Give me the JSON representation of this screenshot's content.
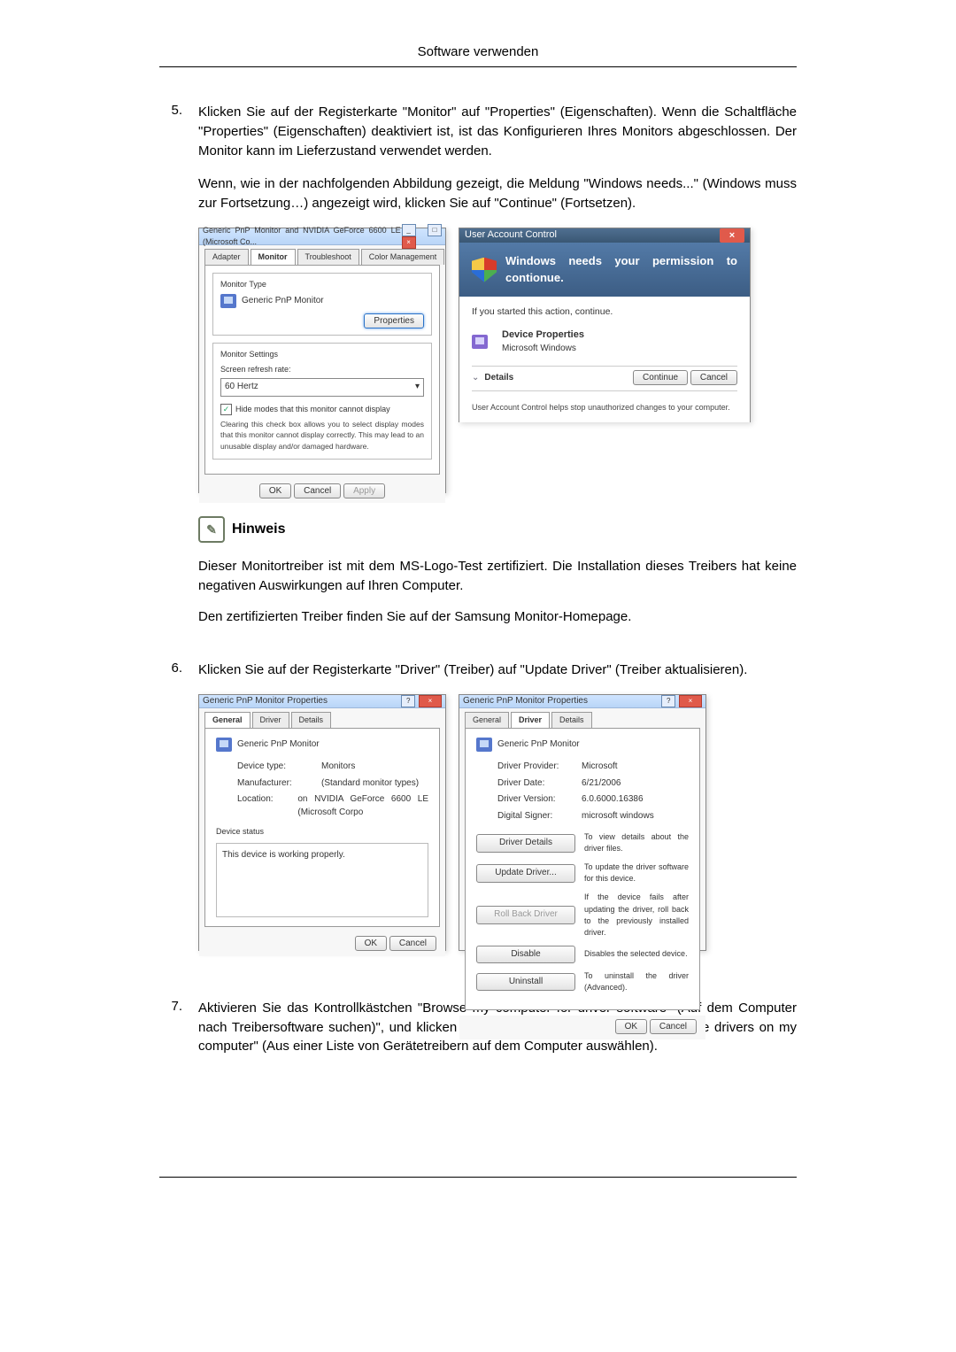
{
  "page_title": "Software verwenden",
  "step5_num": "5.",
  "step5_p1": "Klicken Sie auf der Registerkarte \"Monitor\" auf \"Properties\" (Eigenschaften). Wenn die Schaltfläche \"Properties\" (Eigenschaften) deaktiviert ist, ist das Konfigurieren Ihres Monitors abgeschlossen. Der Monitor kann im Lieferzustand verwendet werden.",
  "step5_p2": "Wenn, wie in der nachfolgenden Abbildung gezeigt, die Meldung \"Windows needs...\" (Windows muss zur Fortsetzung…) angezeigt wird, klicken Sie auf \"Continue\" (Fortsetzen).",
  "d1": {
    "title": "Generic PnP Monitor and NVIDIA GeForce 6600 LE (Microsoft Co...",
    "tab_adapter": "Adapter",
    "tab_monitor": "Monitor",
    "tab_trouble": "Troubleshoot",
    "tab_color": "Color Management",
    "grp_type": "Monitor Type",
    "mon_name": "Generic PnP Monitor",
    "btn_props": "Properties",
    "grp_settings": "Monitor Settings",
    "lbl_refresh": "Screen refresh rate:",
    "val_refresh": "60 Hertz",
    "chk_hide": "Hide modes that this monitor cannot display",
    "hide_help": "Clearing this check box allows you to select display modes that this monitor cannot display correctly. This may lead to an unusable display and/or damaged hardware.",
    "ok": "OK",
    "cancel": "Cancel",
    "apply": "Apply"
  },
  "d2": {
    "title": "User Account Control",
    "heading": "Windows needs your permission to contionue.",
    "hint": "If you started this action, continue.",
    "item_name": "Device Properties",
    "item_pub": "Microsoft Windows",
    "details": "Details",
    "continue": "Continue",
    "cancel": "Cancel",
    "footer": "User Account Control helps stop unauthorized changes to your computer."
  },
  "note_label": "Hinweis",
  "note_p1": "Dieser Monitortreiber ist mit dem MS-Logo-Test zertifiziert. Die Installation dieses Treibers hat keine negativen Auswirkungen auf Ihren Computer.",
  "note_p2": "Den zertifizierten Treiber finden Sie auf der Samsung Monitor-Homepage.",
  "step6_num": "6.",
  "step6_p1": "Klicken Sie auf der Registerkarte \"Driver\" (Treiber) auf \"Update Driver\" (Treiber aktualisieren).",
  "d3": {
    "title": "Generic PnP Monitor Properties",
    "tab_general": "General",
    "tab_driver": "Driver",
    "tab_details": "Details",
    "mon_name": "Generic PnP Monitor",
    "k_type": "Device type:",
    "v_type": "Monitors",
    "k_manu": "Manufacturer:",
    "v_manu": "(Standard monitor types)",
    "k_loc": "Location:",
    "v_loc": "on NVIDIA GeForce 6600 LE (Microsoft Corpo",
    "status_lbl": "Device status",
    "status_txt": "This device is working properly.",
    "ok": "OK",
    "cancel": "Cancel"
  },
  "d4": {
    "title": "Generic PnP Monitor Properties",
    "tab_general": "General",
    "tab_driver": "Driver",
    "tab_details": "Details",
    "mon_name": "Generic PnP Monitor",
    "k_prov": "Driver Provider:",
    "v_prov": "Microsoft",
    "k_date": "Driver Date:",
    "v_date": "6/21/2006",
    "k_ver": "Driver Version:",
    "v_ver": "6.0.6000.16386",
    "k_sign": "Digital Signer:",
    "v_sign": "microsoft windows",
    "b_details": "Driver Details",
    "t_details": "To view details about the driver files.",
    "b_update": "Update Driver...",
    "t_update": "To update the driver software for this device.",
    "b_roll": "Roll Back Driver",
    "t_roll": "If the device fails after updating the driver, roll back to the previously installed driver.",
    "b_disable": "Disable",
    "t_disable": "Disables the selected device.",
    "b_uninstall": "Uninstall",
    "t_uninstall": "To uninstall the driver (Advanced).",
    "ok": "OK",
    "cancel": "Cancel"
  },
  "step7_num": "7.",
  "step7_p1": "Aktivieren Sie das Kontrollkästchen \"Browse my computer for driver software\" (Auf dem Computer nach Treibersoftware suchen)\", und klicken Sie auf \"Let me pick from a list of device drivers on my computer\" (Aus einer Liste von Gerätetreibern auf dem Computer auswählen)."
}
